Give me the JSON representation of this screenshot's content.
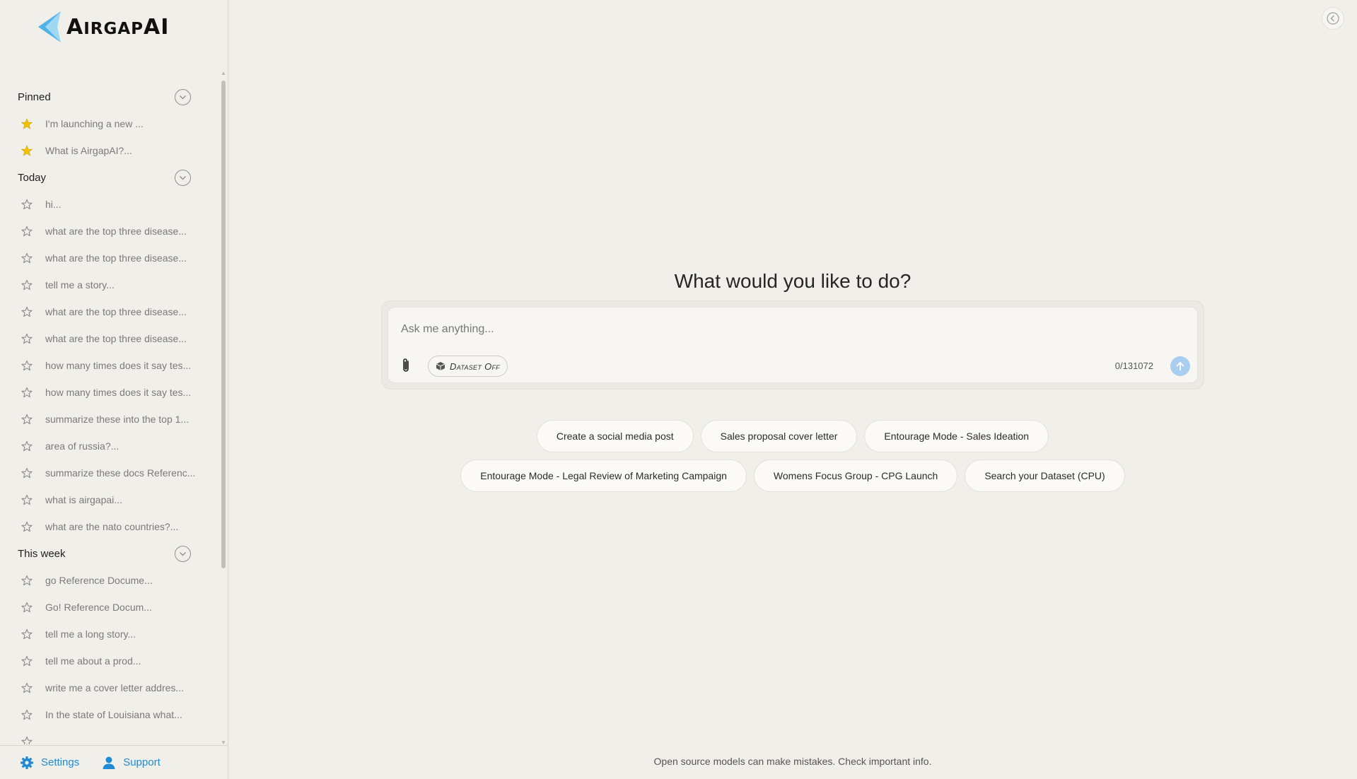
{
  "app": {
    "logo_text_big_1": "A",
    "logo_text_small_1": "IRGAP",
    "logo_text_big_2": "AI",
    "brand_color": "#4fb3e6"
  },
  "sidebar": {
    "sections": [
      {
        "title": "Pinned",
        "items": [
          {
            "label": "I'm launching a new ...",
            "pinned": true
          },
          {
            "label": "What is AirgapAI?...",
            "pinned": true
          }
        ]
      },
      {
        "title": "Today",
        "items": [
          {
            "label": "hi...",
            "pinned": false
          },
          {
            "label": "what are the top three disease...",
            "pinned": false
          },
          {
            "label": "what are the top three disease...",
            "pinned": false
          },
          {
            "label": "tell me a story...",
            "pinned": false
          },
          {
            "label": "what are the top three disease...",
            "pinned": false
          },
          {
            "label": "what are the top three disease...",
            "pinned": false
          },
          {
            "label": "how many times does it say tes...",
            "pinned": false
          },
          {
            "label": "how many times does it say tes...",
            "pinned": false
          },
          {
            "label": "summarize these into the top 1...",
            "pinned": false
          },
          {
            "label": "area of russia?...",
            "pinned": false
          },
          {
            "label": "summarize these docs Referenc...",
            "pinned": false
          },
          {
            "label": "what is airgapai...",
            "pinned": false
          },
          {
            "label": "what are the nato countries?...",
            "pinned": false
          }
        ]
      },
      {
        "title": "This week",
        "items": [
          {
            "label": "go Reference Docume...",
            "pinned": false
          },
          {
            "label": "Go! Reference Docum...",
            "pinned": false
          },
          {
            "label": "tell me a long story...",
            "pinned": false
          },
          {
            "label": "tell me about a prod...",
            "pinned": false
          },
          {
            "label": "write me a cover letter addres...",
            "pinned": false
          },
          {
            "label": "In the state of Louisiana what...",
            "pinned": false
          },
          {
            "label": "",
            "pinned": false
          }
        ]
      }
    ],
    "footer": {
      "settings_label": "Settings",
      "support_label": "Support"
    }
  },
  "main": {
    "headline": "What would you like to do?",
    "composer": {
      "placeholder": "Ask me anything...",
      "value": "",
      "dataset_toggle_label": "Dataset Off",
      "char_count": "0/131072"
    },
    "suggestions": [
      [
        "Create a social media post",
        "Sales proposal cover letter",
        "Entourage Mode - Sales Ideation"
      ],
      [
        "Entourage Mode - Legal Review of Marketing Campaign",
        "Womens Focus Group - CPG Launch",
        "Search your Dataset (CPU)"
      ]
    ],
    "disclaimer": "Open source models can make mistakes. Check important info."
  },
  "colors": {
    "background": "#f1efe9",
    "link": "#1f8ad6",
    "pinned_star": "#f2c200",
    "send_button": "#a9cdef"
  }
}
